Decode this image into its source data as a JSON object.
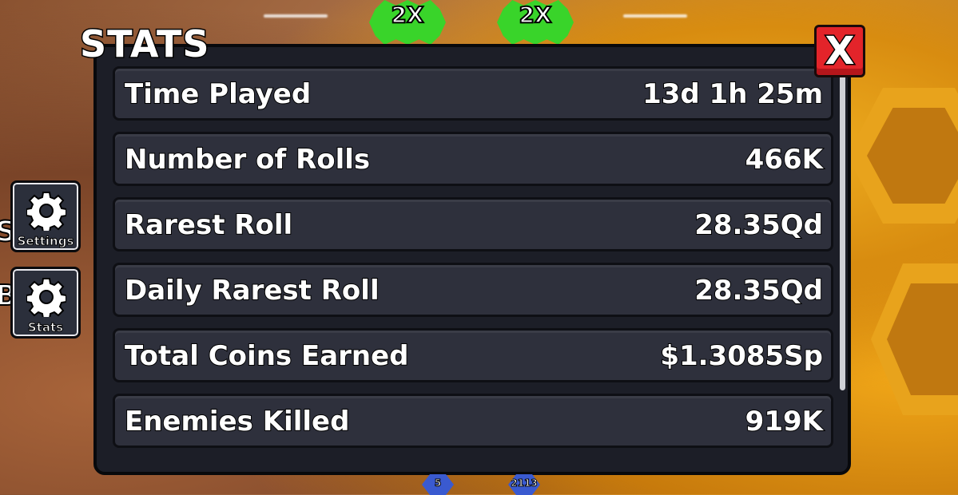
{
  "boosts": [
    {
      "label": "2X"
    },
    {
      "label": "2X"
    }
  ],
  "sidebar": {
    "settings": {
      "label": "Settings",
      "icon": "gear-icon"
    },
    "stats": {
      "label": "Stats",
      "icon": "gear-icon"
    },
    "cut_letters": [
      "S",
      "B"
    ]
  },
  "panel": {
    "title": "STATS",
    "close_label": "X",
    "rows": [
      {
        "label": "Time Played",
        "value": "13d 1h 25m"
      },
      {
        "label": "Number of Rolls",
        "value": "466K"
      },
      {
        "label": "Rarest Roll",
        "value": "28.35Qd"
      },
      {
        "label": "Daily Rarest Roll",
        "value": "28.35Qd"
      },
      {
        "label": "Total Coins Earned",
        "value": "$1.3085Sp"
      },
      {
        "label": "Enemies Killed",
        "value": "919K"
      }
    ]
  },
  "hotbar": [
    {
      "value": "5"
    },
    {
      "value": "2113"
    }
  ],
  "colors": {
    "close_red": "#e3242a",
    "boost_green": "#39d42a",
    "panel_bg": "#1c1e27",
    "row_bg": "#2e303c"
  }
}
